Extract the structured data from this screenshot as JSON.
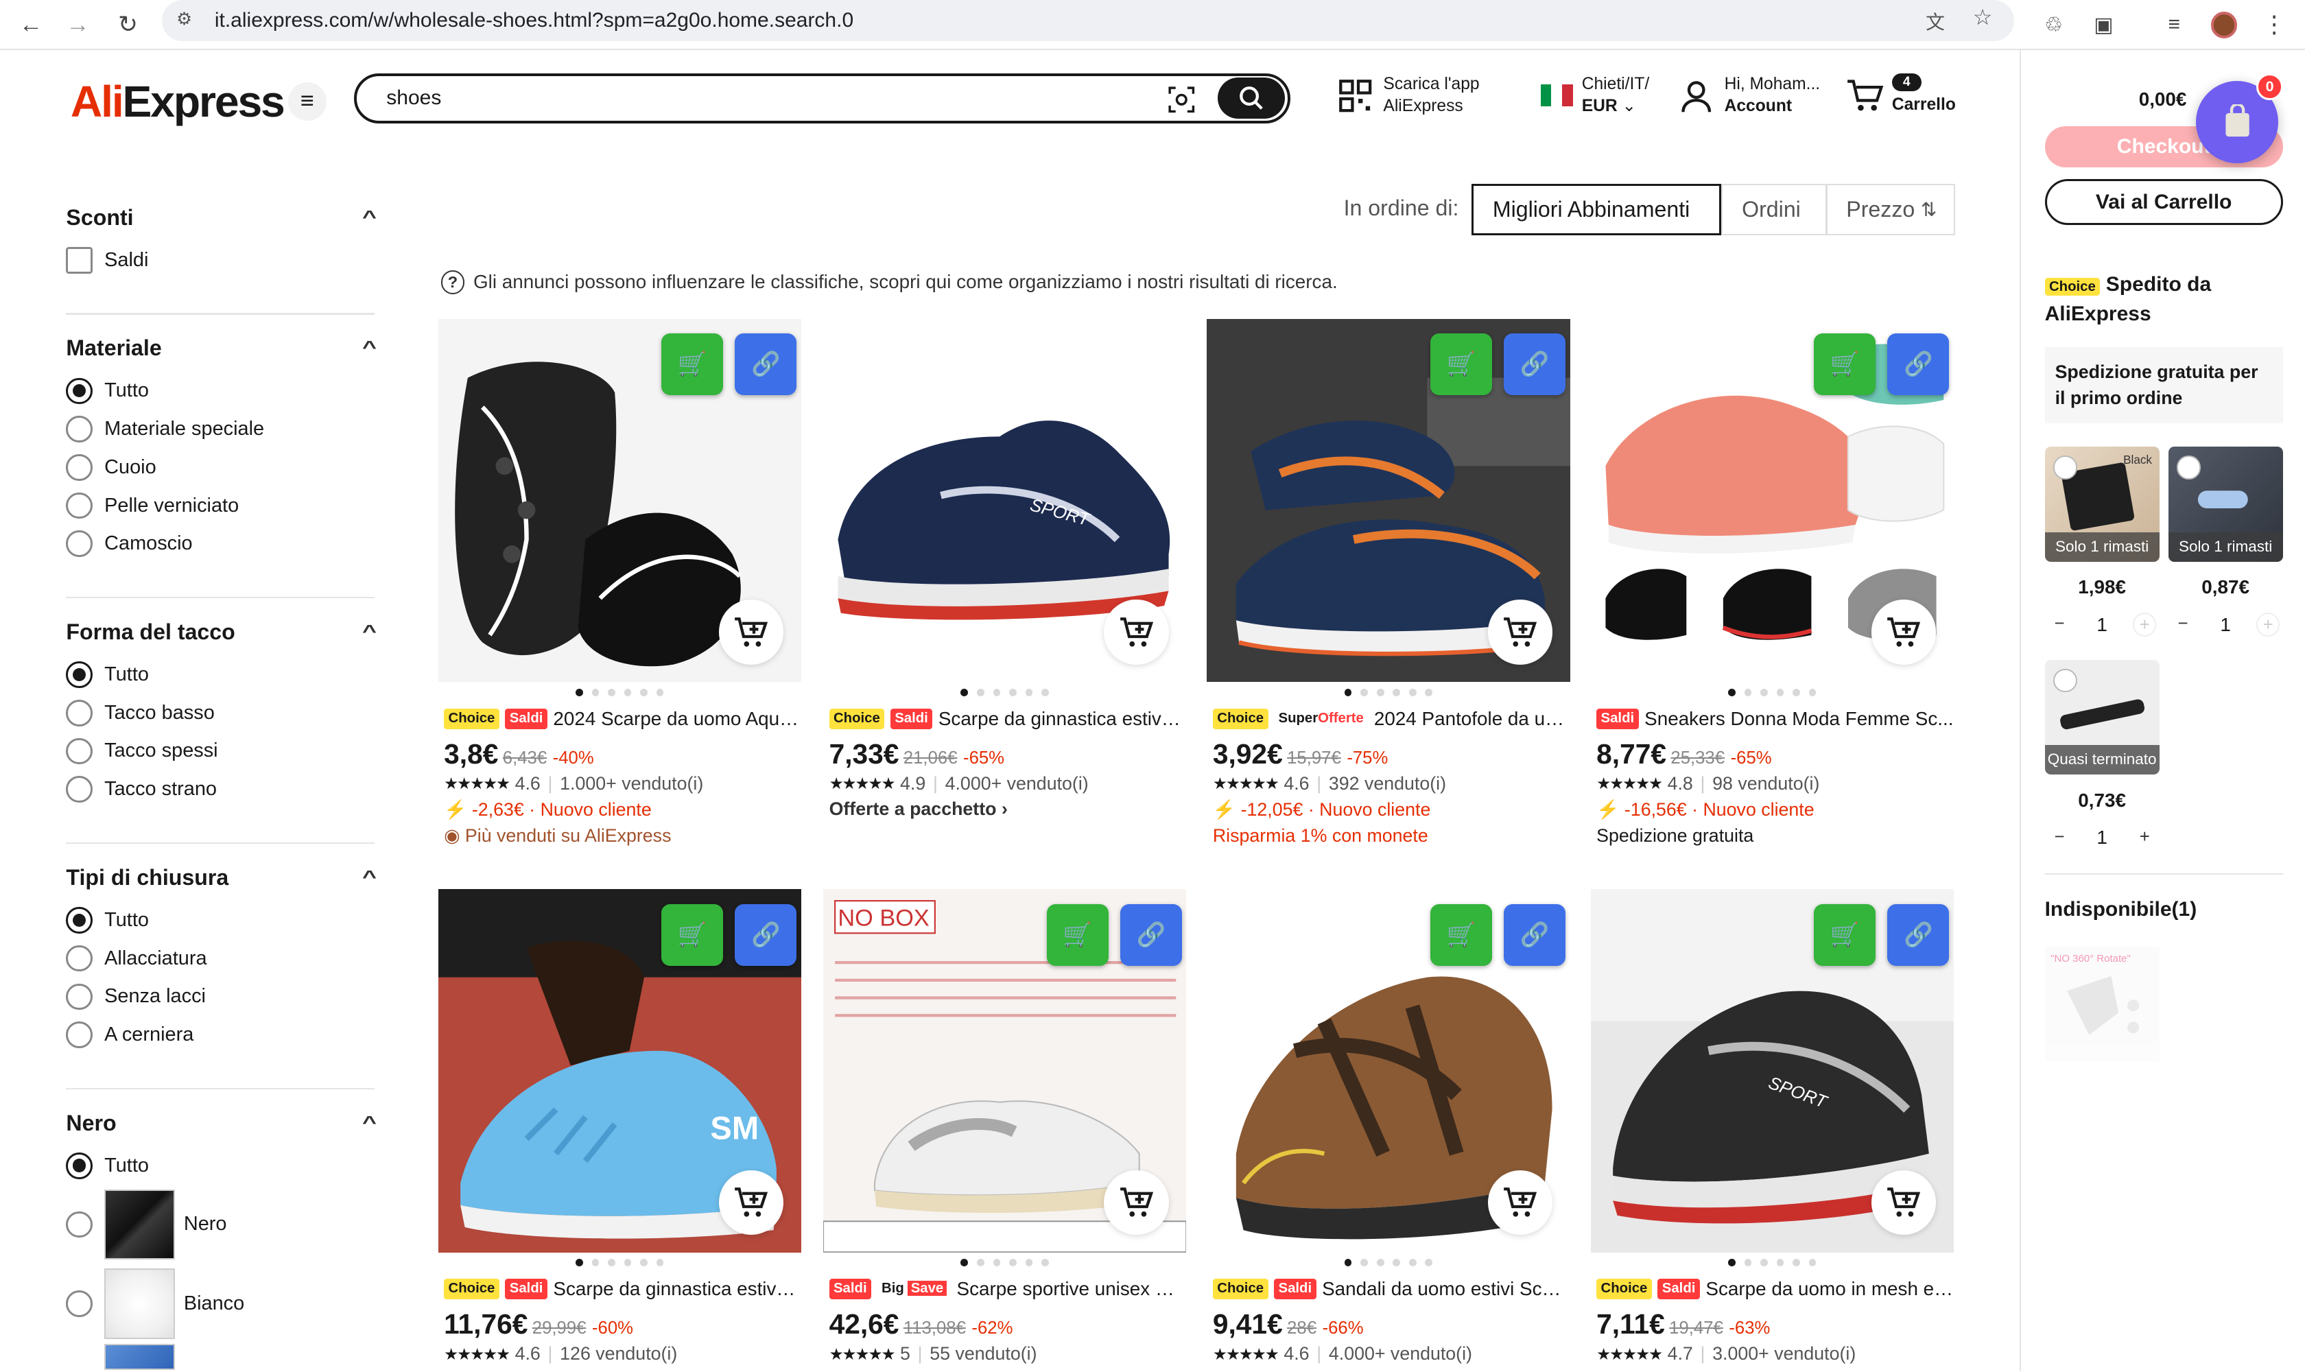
{
  "browser": {
    "url": "it.aliexpress.com/w/wholesale-shoes.html?spm=a2g0o.home.search.0"
  },
  "header": {
    "logo_ali": "Ali",
    "logo_express": "Express",
    "search_value": "shoes",
    "app_line1": "Scarica l'app",
    "app_line2": "AliExpress",
    "region_line1": "Chieti/IT/",
    "region_line2": "EUR",
    "account_line1": "Hi, Moham...",
    "account_line2": "Account",
    "cart_count": "4",
    "cart_label": "Carrello"
  },
  "filters": {
    "sconti": {
      "title": "Sconti",
      "options": [
        "Saldi"
      ]
    },
    "materiale": {
      "title": "Materiale",
      "options": [
        "Tutto",
        "Materiale speciale",
        "Cuoio",
        "Pelle verniciato",
        "Camoscio"
      ]
    },
    "tacco": {
      "title": "Forma del tacco",
      "options": [
        "Tutto",
        "Tacco basso",
        "Tacco spessi",
        "Tacco strano"
      ]
    },
    "chiusura": {
      "title": "Tipi di chiusura",
      "options": [
        "Tutto",
        "Allacciatura",
        "Senza lacci",
        "A cerniera"
      ]
    },
    "colore": {
      "title": "Nero",
      "options": [
        "Tutto",
        "Nero",
        "Bianco"
      ]
    }
  },
  "sort": {
    "label": "In ordine di:",
    "options": [
      "Migliori Abbinamenti",
      "Ordini",
      "Prezzo"
    ],
    "selected": "Migliori Abbinamenti"
  },
  "notice": "Gli annunci possono influenzare le classifiche, scopri qui come organizziamo i nostri risultati di ricerca.",
  "products": [
    {
      "badges": [
        "Choice",
        "Saldi"
      ],
      "title": "2024 Scarpe da uomo Aqua...",
      "price": "3,8€",
      "old": "6,43€",
      "disc": "-40%",
      "rating": "4.6",
      "sold": "1.000+ venduto(i)",
      "line1": "-2,63€ · Nuovo cliente",
      "line2": "Più venduti su AliExpress"
    },
    {
      "badges": [
        "Choice",
        "Saldi"
      ],
      "title": "Scarpe da ginnastica estive...",
      "price": "7,33€",
      "old": "21,06€",
      "disc": "-65%",
      "rating": "4.9",
      "sold": "4.000+ venduto(i)",
      "line1": "Offerte a pacchetto",
      "line2": ""
    },
    {
      "badges": [
        "Choice",
        "SuperOfferte"
      ],
      "title": "2024 Pantofole da uo...",
      "price": "3,92€",
      "old": "15,97€",
      "disc": "-75%",
      "rating": "4.6",
      "sold": "392 venduto(i)",
      "line1": "-12,05€ · Nuovo cliente",
      "line2": "Risparmia 1% con monete"
    },
    {
      "badges": [
        "Saldi"
      ],
      "title": "Sneakers Donna Moda Femme Sc...",
      "price": "8,77€",
      "old": "25,33€",
      "disc": "-65%",
      "rating": "4.8",
      "sold": "98 venduto(i)",
      "line1": "-16,56€ · Nuovo cliente",
      "line2": "Spedizione gratuita"
    },
    {
      "badges": [
        "Choice",
        "Saldi"
      ],
      "title": "Scarpe da ginnastica estive...",
      "price": "11,76€",
      "old": "29,99€",
      "disc": "-60%",
      "rating": "4.6",
      "sold": "126 venduto(i)"
    },
    {
      "badges": [
        "Saldi",
        "BigSave"
      ],
      "title": "Scarpe sportive unisex Sc...",
      "price": "42,6€",
      "old": "113,08€",
      "disc": "-62%",
      "rating": "5",
      "sold": "55 venduto(i)"
    },
    {
      "badges": [
        "Choice",
        "Saldi"
      ],
      "title": "Sandali da uomo estivi Scar...",
      "price": "9,41€",
      "old": "28€",
      "disc": "-66%",
      "rating": "4.6",
      "sold": "4.000+ venduto(i)"
    },
    {
      "badges": [
        "Choice",
        "Saldi"
      ],
      "title": "Scarpe da uomo in mesh es...",
      "price": "7,11€",
      "old": "19,47€",
      "disc": "-63%",
      "rating": "4.7",
      "sold": "3.000+ venduto(i)"
    }
  ],
  "cart": {
    "total": "0,00€",
    "checkout": "Checkout",
    "go": "Vai al Carrello",
    "fab_badge": "0",
    "choice_tag": "Choice",
    "shipped": "Spedito da AliExpress",
    "free": "Spedizione gratuita per il primo ordine",
    "items": [
      {
        "tag": "Solo 1 rimasti",
        "price": "1,98€",
        "qty": "1",
        "label": "Black"
      },
      {
        "tag": "Solo 1 rimasti",
        "price": "0,87€",
        "qty": "1"
      },
      {
        "tag": "Quasi terminato",
        "price": "0,73€",
        "qty": "1"
      }
    ],
    "unavailable": "Indisponibile(1)",
    "unavailable_img_text": "\"NO 360° Rotate\""
  },
  "no_box_text": "NO BOX",
  "colors": {
    "accent": "#e62e04",
    "choice": "#ffe23d",
    "saldi": "#ff3a3a",
    "fab": "#6f5ef0"
  }
}
